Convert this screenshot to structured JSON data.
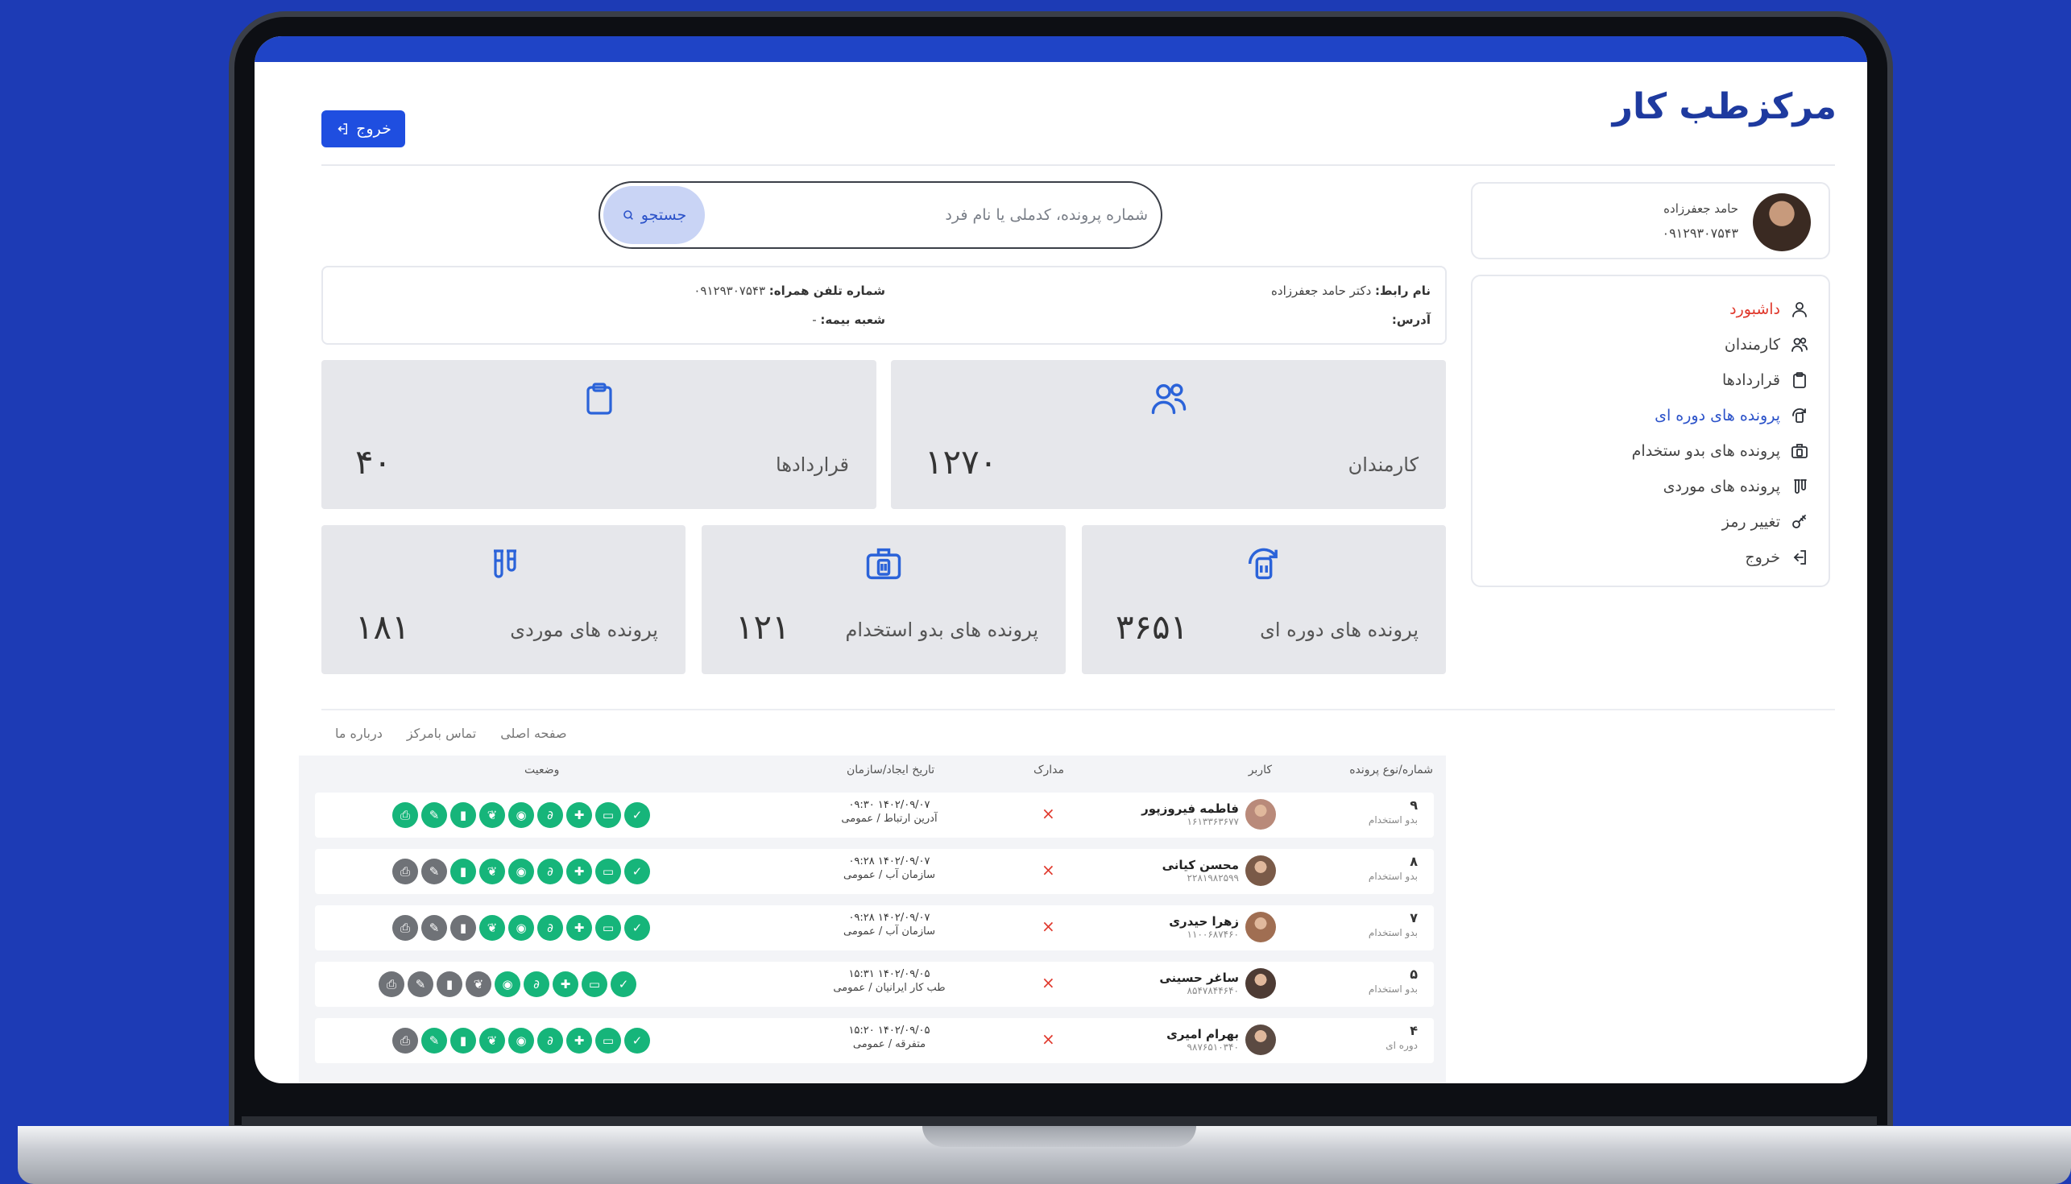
{
  "app": {
    "logo": "مرکزطب کار"
  },
  "header": {
    "logout_label": "خروج"
  },
  "profile": {
    "name": "حامد جعفرزاده",
    "phone": "۰۹۱۲۹۳۰۷۵۴۳"
  },
  "menu": [
    {
      "label": "داشبورد",
      "icon": "user-icon",
      "state": "active"
    },
    {
      "label": "کارمندان",
      "icon": "users-icon",
      "state": ""
    },
    {
      "label": "قراردادها",
      "icon": "clipboard-icon",
      "state": ""
    },
    {
      "label": "پرونده های دوره ای",
      "icon": "periodic-file-icon",
      "state": "blue"
    },
    {
      "label": "پرونده های بدو ستخدام",
      "icon": "briefcase-icon",
      "state": ""
    },
    {
      "label": "پرونده های موردی",
      "icon": "tube-icon",
      "state": ""
    },
    {
      "label": "تغییر رمز",
      "icon": "key-icon",
      "state": ""
    },
    {
      "label": "خروج",
      "icon": "logout-icon",
      "state": ""
    }
  ],
  "search": {
    "placeholder": "شماره پرونده، کدملی یا نام فرد",
    "button": "جستجو"
  },
  "info": {
    "contact_label": "نام رابط:",
    "contact_value": "دکتر حامد جعفرزاده",
    "address_label": "آدرس:",
    "address_value": "",
    "phone_label": "شماره تلفن همراه:",
    "phone_value": "۰۹۱۲۹۳۰۷۵۴۳",
    "branch_label": "شعبه بیمه:",
    "branch_value": "-"
  },
  "stats": {
    "employees": {
      "label": "کارمندان",
      "value": "۱۲۷۰",
      "icon": "users-icon"
    },
    "contracts": {
      "label": "قراردادها",
      "value": "۴۰",
      "icon": "clipboard-icon"
    },
    "periodic": {
      "label": "پرونده های دوره ای",
      "value": "۳۶۵۱",
      "icon": "periodic-file-icon"
    },
    "hiring": {
      "label": "پرونده های بدو استخدام",
      "value": "۱۲۱",
      "icon": "briefcase-icon"
    },
    "case": {
      "label": "پرونده های موردی",
      "value": "۱۸۱",
      "icon": "tube-icon"
    }
  },
  "footer": {
    "home": "صفحه اصلی",
    "contact": "تماس بامرکز",
    "about": "درباره ما"
  },
  "table": {
    "headers": {
      "number": "شماره/نوع پرونده",
      "user": "کاربر",
      "docs": "مدارک",
      "date": "تاریخ ایجاد/سازمان",
      "status": "وضعیت"
    },
    "rows": [
      {
        "num": "۹",
        "type": "بدو استخدام",
        "name": "فاطمه فیروزپور",
        "id": "۱۶۱۳۳۶۳۶۷۷",
        "date": "۱۴۰۲/۰۹/۰۷ ۰۹:۳۰",
        "org": "آدرین ارتباط / عمومی",
        "docs": "×",
        "status_gray": 0
      },
      {
        "num": "۸",
        "type": "بدو استخدام",
        "name": "محسن کیانی",
        "id": "۲۲۸۱۹۸۲۵۹۹",
        "date": "۱۴۰۲/۰۹/۰۷ ۰۹:۲۸",
        "org": "سازمان آب / عمومی",
        "docs": "×",
        "status_gray": 2
      },
      {
        "num": "۷",
        "type": "بدو استخدام",
        "name": "زهرا حیدری",
        "id": "۱۱۰۰۶۸۷۴۶۰",
        "date": "۱۴۰۲/۰۹/۰۷ ۰۹:۲۸",
        "org": "سازمان آب / عمومی",
        "docs": "×",
        "status_gray": 3
      },
      {
        "num": "۵",
        "type": "بدو استخدام",
        "name": "ساغر حسینی",
        "id": "۸۵۴۷۸۴۴۶۴۰",
        "date": "۱۴۰۲/۰۹/۰۵ ۱۵:۳۱",
        "org": "طب کار ایرانیان / عمومی",
        "docs": "×",
        "status_gray": 4
      },
      {
        "num": "۴",
        "type": "دوره ای",
        "name": "بهرام امیری",
        "id": "۹۸۷۶۵۱۰۳۴۰",
        "date": "۱۴۰۲/۰۹/۰۵ ۱۵:۲۰",
        "org": "متفرقه / عمومی",
        "docs": "×",
        "status_gray": 1
      }
    ]
  },
  "colors": {
    "brand": "#1f4ee0",
    "logo": "#1e3a9f",
    "active": "#e0392d",
    "status_ok": "#16b57a",
    "status_off": "#6f7277"
  }
}
